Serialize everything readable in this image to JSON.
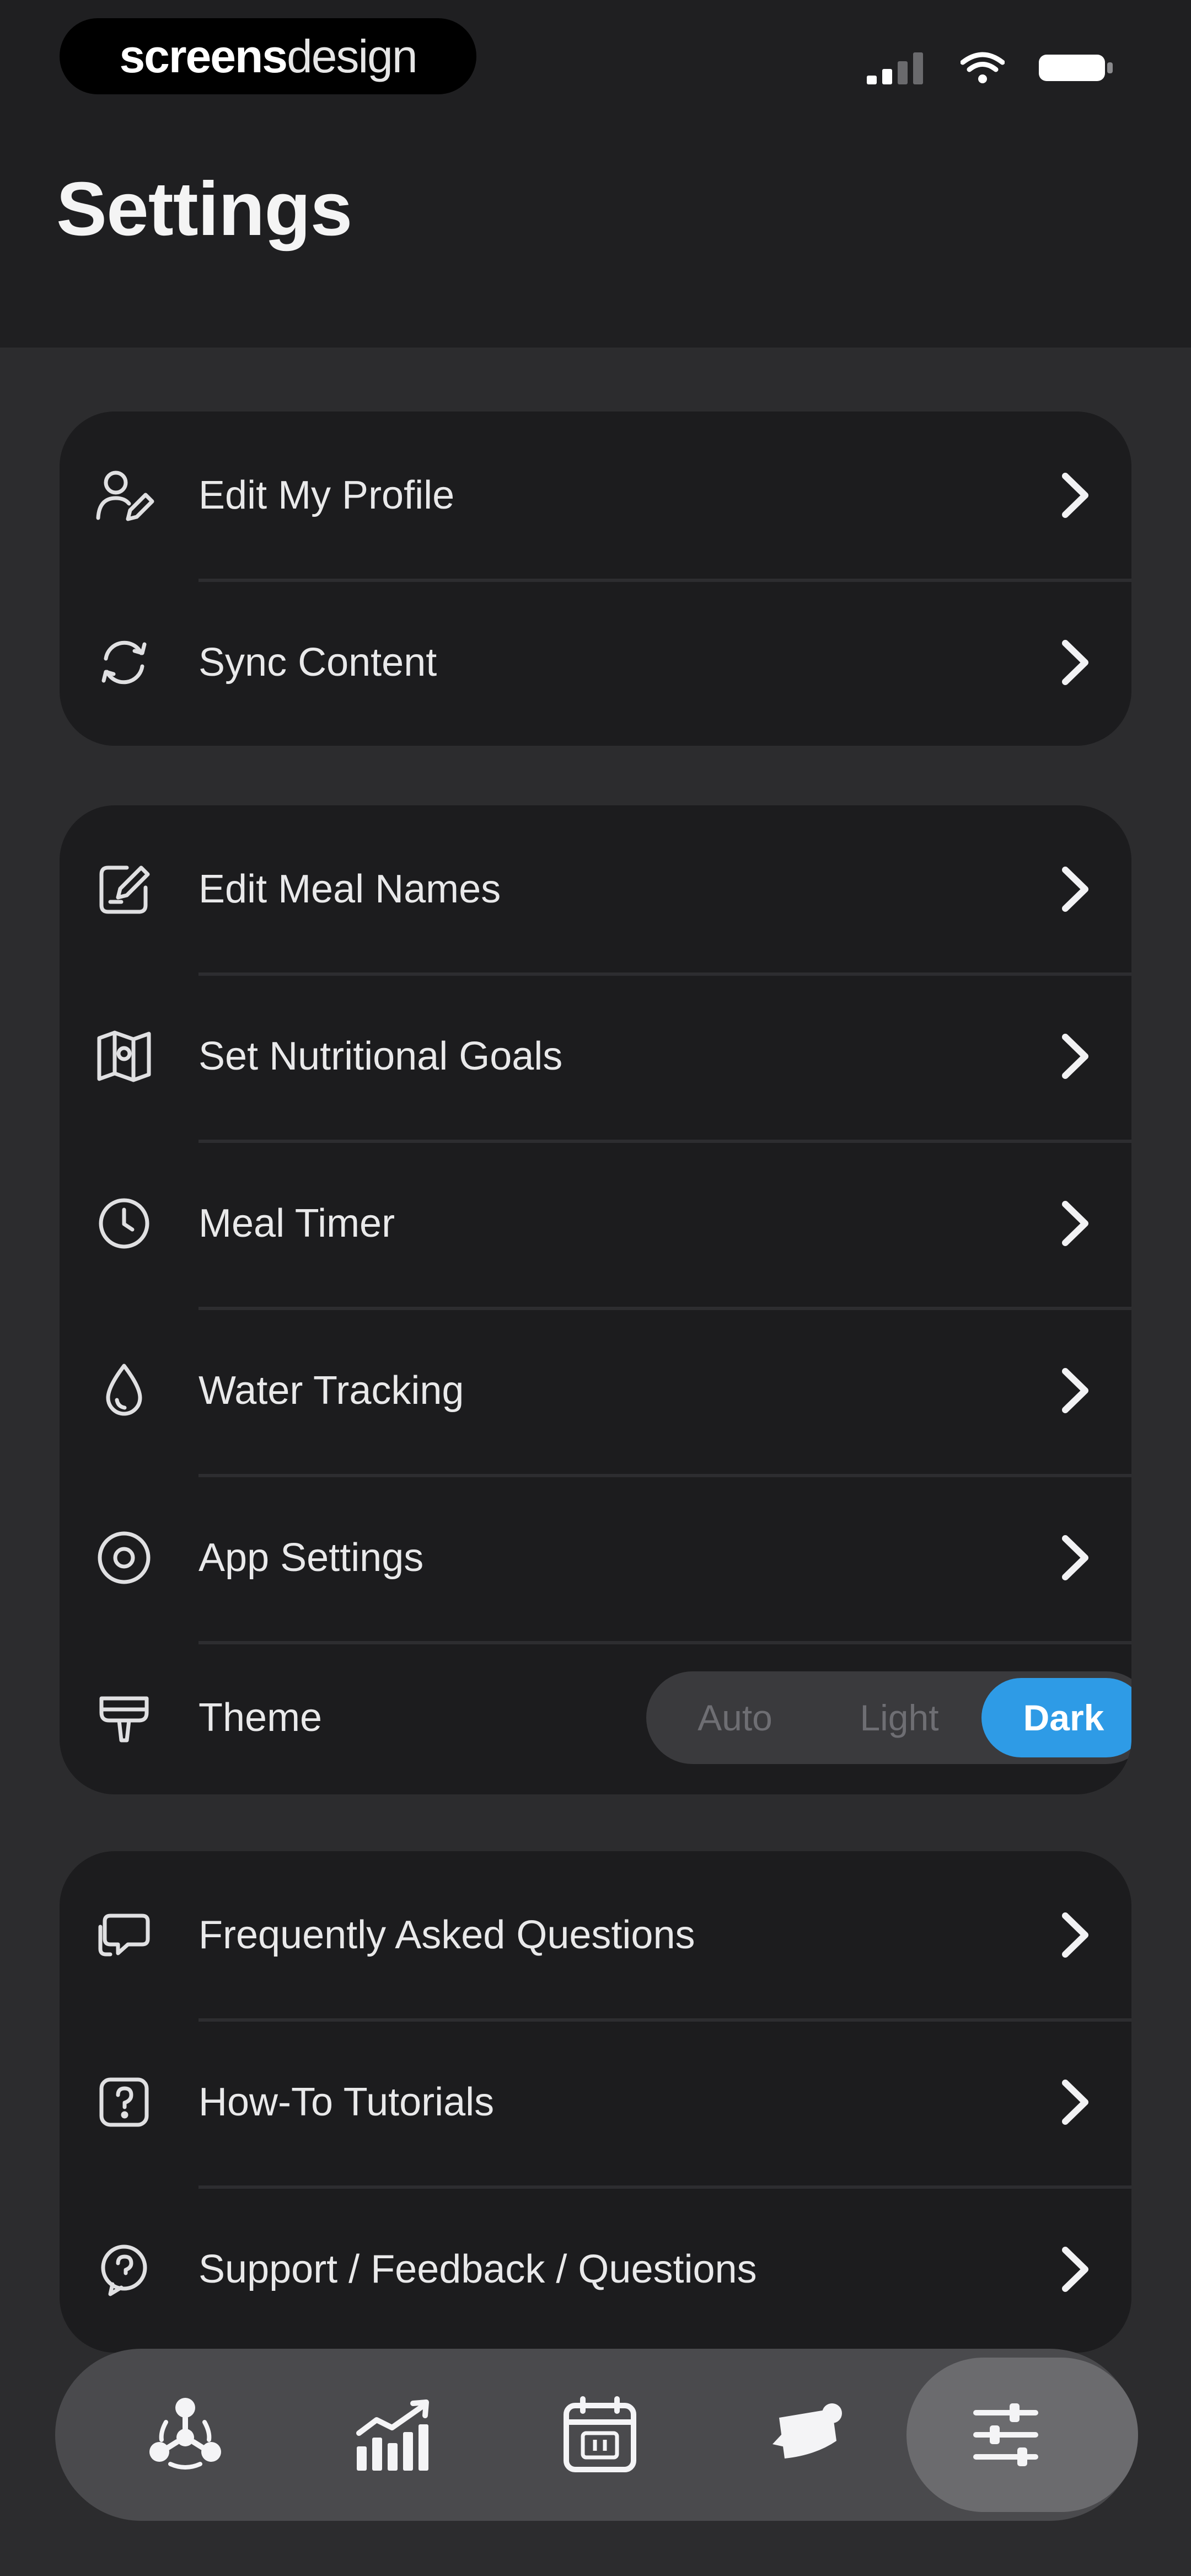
{
  "status_bar": {
    "brand_bold": "screens",
    "brand_light": "design",
    "icons": [
      "signal-icon",
      "wifi-icon",
      "battery-icon"
    ]
  },
  "header": {
    "title": "Settings"
  },
  "groups": [
    {
      "items": [
        {
          "label": "Edit My Profile",
          "icon": "profile-edit-icon"
        },
        {
          "label": "Sync Content",
          "icon": "sync-icon"
        }
      ]
    },
    {
      "items": [
        {
          "label": "Edit Meal Names",
          "icon": "edit-note-icon"
        },
        {
          "label": "Set Nutritional Goals",
          "icon": "goals-icon"
        },
        {
          "label": "Meal Timer",
          "icon": "clock-icon"
        },
        {
          "label": "Water Tracking",
          "icon": "water-drop-icon"
        },
        {
          "label": "App Settings",
          "icon": "app-settings-icon"
        }
      ],
      "theme": {
        "label": "Theme",
        "icon": "theme-icon",
        "options": [
          "Auto",
          "Light",
          "Dark"
        ],
        "selected": "Dark"
      }
    },
    {
      "items": [
        {
          "label": "Frequently Asked Questions",
          "icon": "faq-icon"
        },
        {
          "label": "How-To Tutorials",
          "icon": "tutorial-icon"
        },
        {
          "label": "Support / Feedback / Questions",
          "icon": "support-icon"
        }
      ]
    }
  ],
  "tabbar": {
    "tabs": [
      {
        "icon": "nutrients-icon"
      },
      {
        "icon": "progress-chart-icon"
      },
      {
        "icon": "calendar-icon"
      },
      {
        "icon": "food-icon"
      },
      {
        "icon": "settings-sliders-icon"
      }
    ],
    "active_index": 4
  },
  "colors": {
    "background": "#2c2c2e",
    "header": "#1f1f21",
    "card": "#1c1c1e",
    "accent": "#2e9be6",
    "text": "#e9e9ea"
  }
}
